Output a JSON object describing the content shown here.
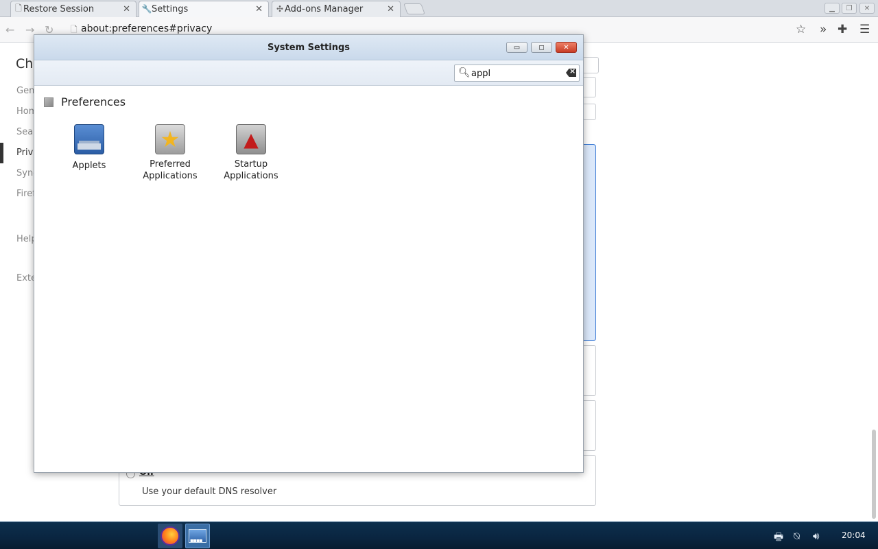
{
  "browser": {
    "tabs": [
      {
        "label": "Restore Session",
        "icon": "page-icon",
        "active": false
      },
      {
        "label": "Settings",
        "icon": "wrench-icon",
        "active": true
      },
      {
        "label": "Add-ons Manager",
        "icon": "puzzle-icon",
        "active": false
      }
    ],
    "url": "about:preferences#privacy"
  },
  "background_page": {
    "title": "Chr",
    "nav_items": [
      "Gene",
      "Hom",
      "Sear",
      "Priva",
      "Sync",
      "Firef",
      "Help",
      "Exte"
    ],
    "dns_off_label": "Off",
    "dns_off_description": "Use your default DNS resolver"
  },
  "dialog": {
    "title": "System Settings",
    "search": {
      "value": "appl",
      "placeholder": ""
    },
    "section": {
      "label": "Preferences"
    },
    "items": [
      {
        "label": "Applets",
        "icon": "applets-icon"
      },
      {
        "label": "Preferred Applications",
        "icon": "star-icon"
      },
      {
        "label": "Startup Applications",
        "icon": "rocket-icon"
      }
    ]
  },
  "taskbar": {
    "apps": [
      "firefox",
      "system-settings"
    ],
    "clock": "20:04"
  },
  "colors": {
    "taskbar_bg": "#0a2540",
    "dialog_titlebar": "#c9d9eb",
    "close_button": "#c83c25",
    "selection_blue": "#3d7cd6"
  }
}
